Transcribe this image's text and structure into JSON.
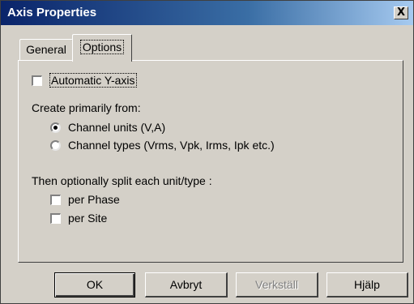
{
  "window": {
    "title": "Axis Properties",
    "close_glyph": "X"
  },
  "tabs": [
    {
      "label": "General",
      "selected": false
    },
    {
      "label": "Options",
      "selected": true
    }
  ],
  "options": {
    "auto_y_axis": {
      "label": "Automatic Y-axis",
      "checked": false
    },
    "create_heading": "Create primarily from:",
    "create_choices": [
      {
        "label": "Channel units (V,A)",
        "selected": true
      },
      {
        "label": "Channel types (Vrms, Vpk, Irms, Ipk etc.)",
        "selected": false
      }
    ],
    "split_heading": "Then optionally split each unit/type :",
    "split_choices": [
      {
        "label": "per Phase",
        "checked": false
      },
      {
        "label": "per Site",
        "checked": false
      }
    ]
  },
  "buttons": {
    "ok": "OK",
    "cancel": "Avbryt",
    "apply": "Verkställ",
    "help": "Hjälp"
  }
}
